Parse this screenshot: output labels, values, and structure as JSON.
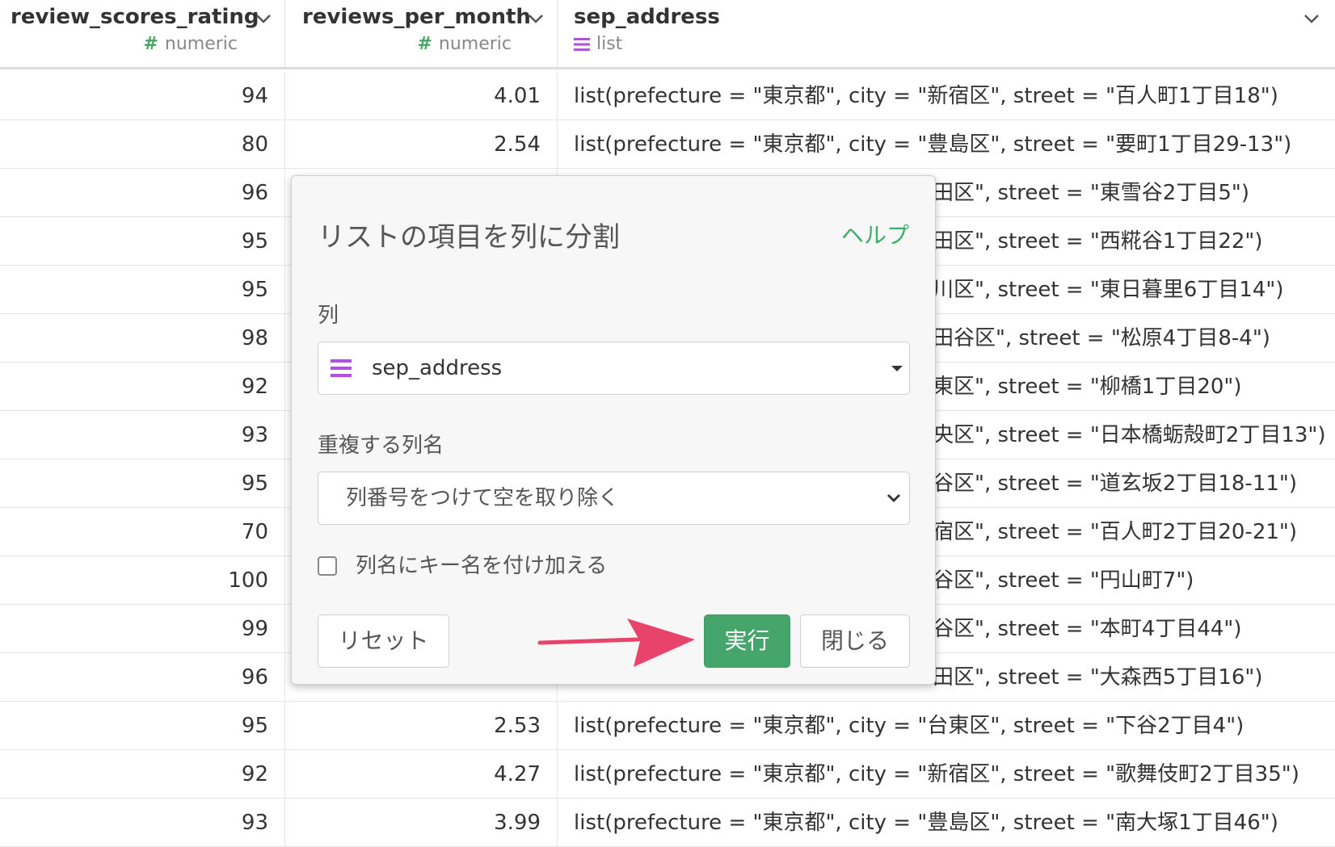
{
  "columns": [
    {
      "name": "review_scores_rating",
      "type": "numeric",
      "type_icon": "hash-icon"
    },
    {
      "name": "reviews_per_month",
      "type": "numeric",
      "type_icon": "hash-icon"
    },
    {
      "name": "sep_address",
      "type": "list",
      "type_icon": "list-icon"
    }
  ],
  "rows": [
    [
      "94",
      "4.01",
      "list(prefecture = \"東京都\", city = \"新宿区\", street = \"百人町1丁目18\")"
    ],
    [
      "80",
      "2.54",
      "list(prefecture = \"東京都\", city = \"豊島区\", street = \"要町1丁目29-13\")"
    ],
    [
      "96",
      "",
      "田区\", street = \"東雪谷2丁目5\")"
    ],
    [
      "95",
      "",
      "田区\", street = \"西糀谷1丁目22\")"
    ],
    [
      "95",
      "",
      "川区\", street = \"東日暮里6丁目14\")"
    ],
    [
      "98",
      "",
      "田谷区\", street = \"松原4丁目8-4\")"
    ],
    [
      "92",
      "",
      "東区\", street = \"柳橋1丁目20\")"
    ],
    [
      "93",
      "",
      "央区\", street = \"日本橋蛎殻町2丁目13\")"
    ],
    [
      "95",
      "",
      "谷区\", street = \"道玄坂2丁目18-11\")"
    ],
    [
      "70",
      "",
      "宿区\", street = \"百人町2丁目20-21\")"
    ],
    [
      "100",
      "",
      "谷区\", street = \"円山町7\")"
    ],
    [
      "99",
      "",
      "谷区\", street = \"本町4丁目44\")"
    ],
    [
      "96",
      "",
      "田区\", street = \"大森西5丁目16\")"
    ],
    [
      "95",
      "2.53",
      "list(prefecture = \"東京都\", city = \"台東区\", street = \"下谷2丁目4\")"
    ],
    [
      "92",
      "4.27",
      "list(prefecture = \"東京都\", city = \"新宿区\", street = \"歌舞伎町2丁目35\")"
    ],
    [
      "93",
      "3.99",
      "list(prefecture = \"東京都\", city = \"豊島区\", street = \"南大塚1丁目46\")"
    ]
  ],
  "dialog": {
    "title": "リストの項目を列に分割",
    "help_label": "ヘルプ",
    "column_label": "列",
    "column_value": "sep_address",
    "duplicate_label": "重複する列名",
    "duplicate_value": "列番号をつけて空を取り除く",
    "add_key_label": "列名にキー名を付け加える",
    "add_key_checked": false,
    "reset_label": "リセット",
    "run_label": "実行",
    "close_label": "閉じる"
  },
  "colors": {
    "accent_green": "#45a56a",
    "numeric_icon": "#4aa564",
    "list_icon": "#b44ee0",
    "arrow": "#e8436a"
  }
}
